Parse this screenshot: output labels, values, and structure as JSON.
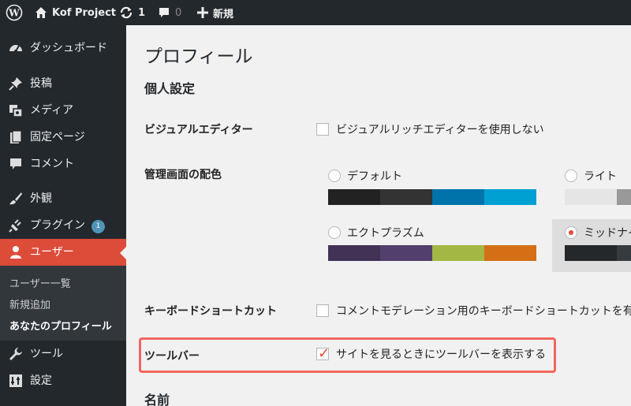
{
  "adminbar": {
    "site_name": "Kof Project",
    "updates_count": "1",
    "comments_count": "0",
    "new_label": "新規"
  },
  "sidebar": {
    "items": [
      {
        "label": "ダッシュボード",
        "icon": "dashboard-icon"
      },
      {
        "label": "投稿",
        "icon": "pin-icon"
      },
      {
        "label": "メディア",
        "icon": "media-icon"
      },
      {
        "label": "固定ページ",
        "icon": "page-icon"
      },
      {
        "label": "コメント",
        "icon": "comment-icon"
      },
      {
        "label": "外観",
        "icon": "brush-icon"
      },
      {
        "label": "プラグイン",
        "icon": "plugin-icon",
        "badge": "1"
      },
      {
        "label": "ユーザー",
        "icon": "user-icon"
      },
      {
        "label": "ツール",
        "icon": "wrench-icon"
      },
      {
        "label": "設定",
        "icon": "settings-icon"
      }
    ],
    "submenu": [
      "ユーザー一覧",
      "新規追加",
      "あなたのプロフィール"
    ]
  },
  "main": {
    "title": "プロフィール",
    "section_personal": "個人設定",
    "section_name": "名前",
    "visual_editor_label": "ビジュアルエディター",
    "visual_editor_option": "ビジュアルリッチエディターを使用しない",
    "color_scheme_label": "管理画面の配色",
    "schemes": [
      {
        "name": "デフォルト",
        "colors": [
          "#222222",
          "#333333",
          "#0073aa",
          "#00a0d2"
        ]
      },
      {
        "name": "ライト",
        "colors": [
          "#e5e5e5",
          "#999999"
        ]
      },
      {
        "name": "エクトプラズム",
        "colors": [
          "#413256",
          "#523f6d",
          "#a3b745",
          "#d46f15"
        ]
      },
      {
        "name": "ミッドナイ",
        "colors": [
          "#25282b",
          "#363b3f"
        ]
      }
    ],
    "keyboard_label": "キーボードショートカット",
    "keyboard_option": "コメントモデレーション用のキーボードショートカットを有",
    "toolbar_label": "ツールバー",
    "toolbar_option": "サイトを見るときにツールバーを表示する"
  },
  "colors": {
    "accent": "#dd4b39",
    "highlight_border": "#f0675e",
    "sidebar_bg": "#23282d"
  }
}
